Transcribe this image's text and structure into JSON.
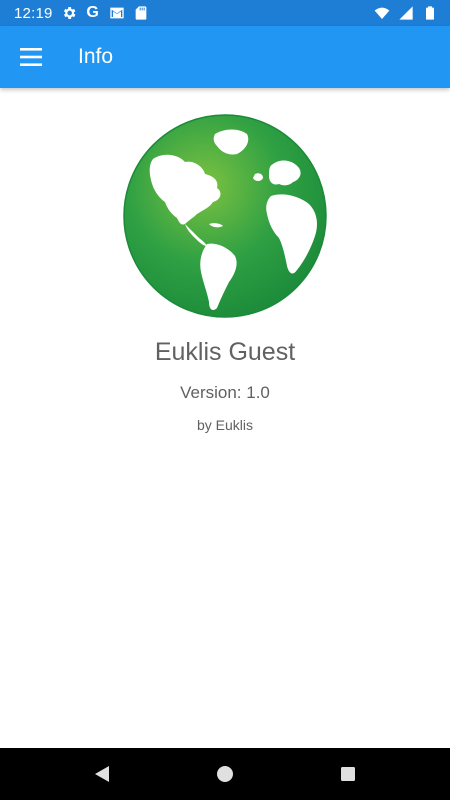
{
  "status_bar": {
    "time": "12:19",
    "left_icons": [
      "gear-icon",
      "google-g-icon",
      "gmail-icon",
      "sd-card-icon"
    ],
    "google_glyph": "G",
    "right_icons": [
      "wifi-icon",
      "cell-signal-icon",
      "battery-icon"
    ]
  },
  "app_bar": {
    "title": "Info",
    "menu_icon": "hamburger-menu-icon",
    "color": "#2196f3"
  },
  "about": {
    "logo": "green-globe-icon",
    "app_name": "Euklis Guest",
    "version": "Version: 1.0",
    "author": "by Euklis"
  },
  "nav_bar": {
    "buttons": [
      "back-triangle-icon",
      "home-circle-icon",
      "recents-square-icon"
    ]
  },
  "colors": {
    "status_bar": "#1e7ed6",
    "app_bar": "#2196f3",
    "globe_green": "#2e9e3f",
    "text_gray": "#616161"
  }
}
